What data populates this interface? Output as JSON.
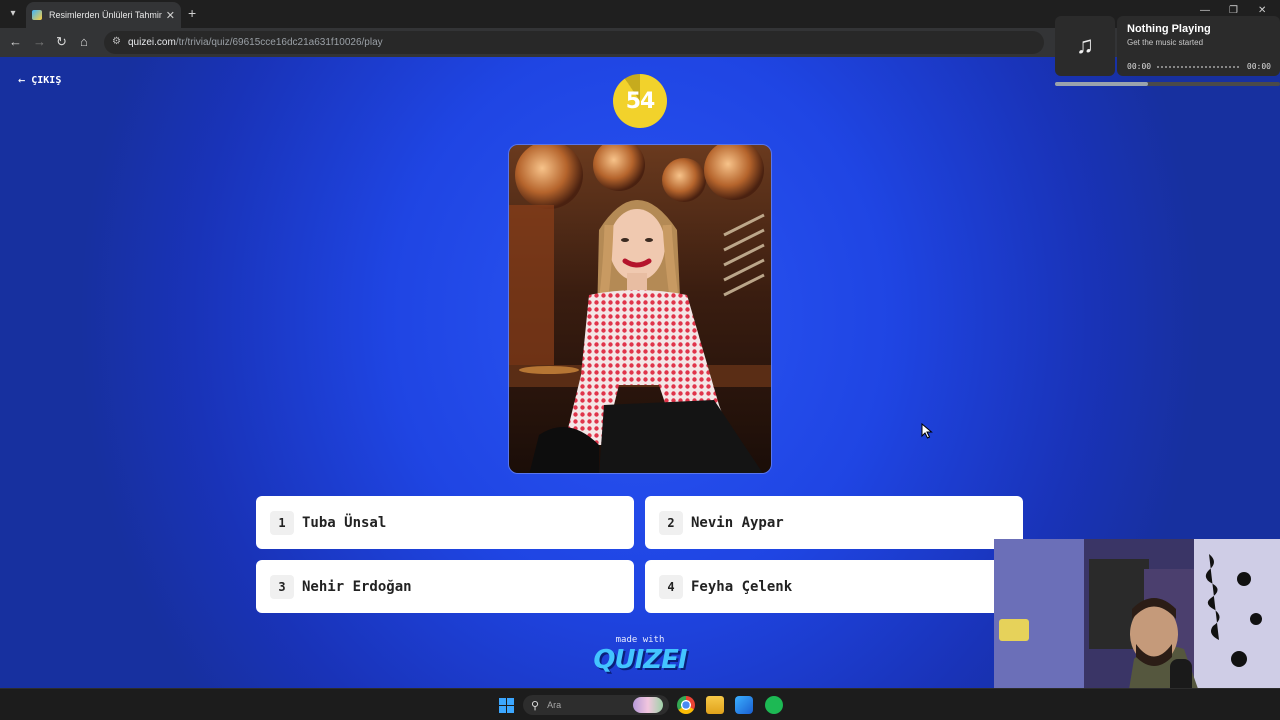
{
  "browser": {
    "tab_title": "Resimlerden Ünlüleri Tahmin Et",
    "url_host": "quizei.com",
    "url_path": "/tr/trivia/quiz/69615cce16dc21a631f10026/play"
  },
  "quiz": {
    "exit_label": "ÇIKIŞ",
    "timer_value": "54",
    "answers": [
      {
        "number": "1",
        "text": "Tuba Ünsal"
      },
      {
        "number": "2",
        "text": "Nevin Aypar"
      },
      {
        "number": "3",
        "text": "Nehir Erdoğan"
      },
      {
        "number": "4",
        "text": "Feyha Çelenk"
      }
    ],
    "made_with": "made with",
    "brand": "QUIZEI"
  },
  "media_player": {
    "title": "Nothing Playing",
    "subtitle": "Get the music started",
    "time_start": "00:00",
    "time_end": "00:00"
  },
  "taskbar": {
    "search_placeholder": "Ara"
  },
  "colors": {
    "page_bg": "#1f45e3",
    "timer": "#f2d22b",
    "brand": "#43c4ff"
  }
}
